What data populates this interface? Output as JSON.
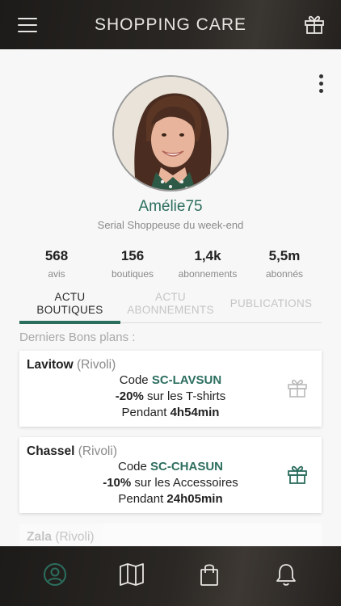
{
  "header": {
    "title": "SHOPPING CARE"
  },
  "profile": {
    "username": "Amélie75",
    "tagline": "Serial Shoppeuse du week-end"
  },
  "stats": [
    {
      "value": "568",
      "label": "avis"
    },
    {
      "value": "156",
      "label": "boutiques"
    },
    {
      "value": "1,4k",
      "label": "abonnements"
    },
    {
      "value": "5,5m",
      "label": "abonnés"
    }
  ],
  "tabs": [
    {
      "line1": "ACTU",
      "line2": "BOUTIQUES",
      "active": true
    },
    {
      "line1": "ACTU",
      "line2": "ABONNEMENTS",
      "active": false
    },
    {
      "line1": "PUBLICATIONS",
      "line2": "",
      "active": false
    }
  ],
  "section_label": "Derniers Bons plans :",
  "deals": [
    {
      "shop": "Lavitow",
      "location": "(Rivoli)",
      "code_prefix": "Code ",
      "code": "SC-LAVSUN",
      "discount": "-20%",
      "discount_text": " sur les T-shirts",
      "duration_prefix": "Pendant ",
      "duration": "4h54min",
      "gift_color": "#b9b9b9"
    },
    {
      "shop": "Chassel",
      "location": "(Rivoli)",
      "code_prefix": "Code ",
      "code": "SC-CHASUN",
      "discount": "-10%",
      "discount_text": " sur les Accessoires",
      "duration_prefix": "Pendant ",
      "duration": "24h05min",
      "gift_color": "#2c6e5e"
    }
  ],
  "partial_deal": {
    "shop": "Zala",
    "location": "(Rivoli)"
  },
  "colors": {
    "accent": "#2c6e5e",
    "bar": "#24211f"
  },
  "icons": {
    "menu": "menu-icon",
    "gift": "gift-icon",
    "profile": "profile-icon",
    "map": "map-icon",
    "bag": "shopping-bag-icon",
    "bell": "bell-icon"
  }
}
